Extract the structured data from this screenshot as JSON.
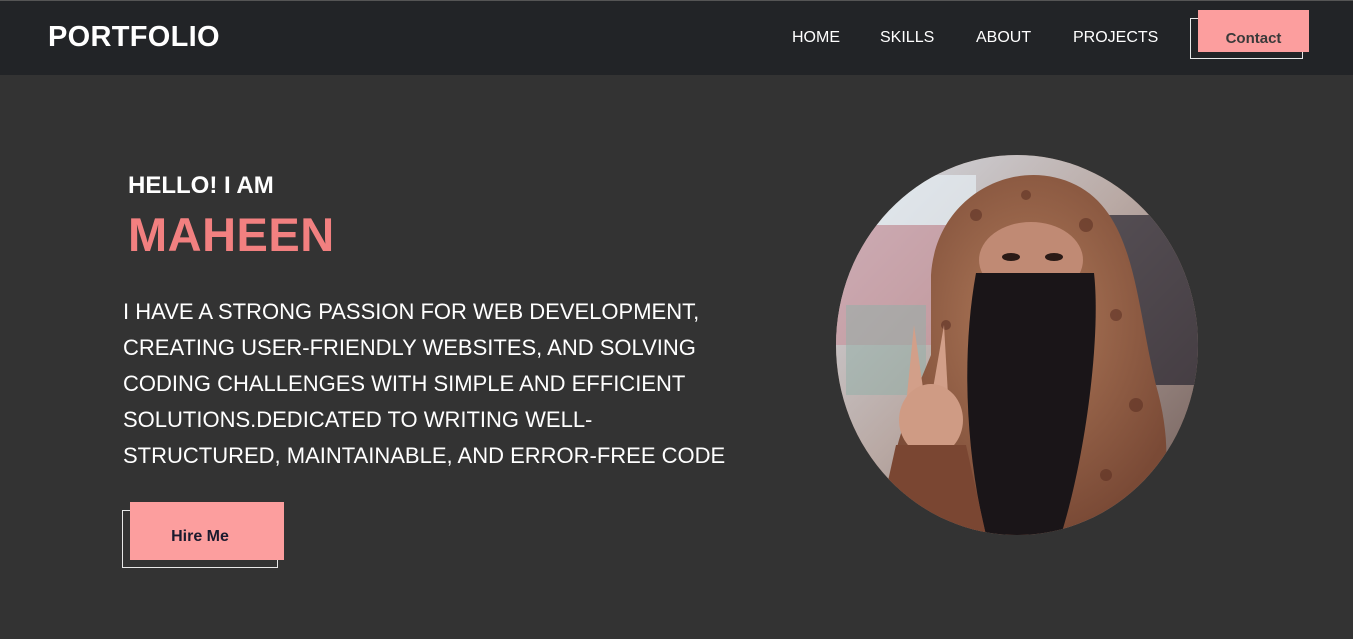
{
  "nav": {
    "logo": "PORTFOLIO",
    "links": [
      "HOME",
      "SKILLS",
      "ABOUT",
      "PROJECTS"
    ],
    "contact_label": "Contact"
  },
  "hero": {
    "greeting": "HELLO! I AM",
    "name": "MAHEEN",
    "bio": "I HAVE A STRONG PASSION FOR WEB DEVELOPMENT, CREATING USER-FRIENDLY WEBSITES, AND SOLVING CODING CHALLENGES WITH SIMPLE AND EFFICIENT SOLUTIONS.DEDICATED TO WRITING WELL-STRUCTURED, MAINTAINABLE, AND ERROR-FREE CODE",
    "hire_label": "Hire Me"
  },
  "colors": {
    "background": "#333333",
    "navbar": "#222427",
    "accent": "#fc9e9e",
    "name_color": "#f28080",
    "text": "#ffffff"
  },
  "icons": {
    "profile_photo": "profile-photo"
  }
}
